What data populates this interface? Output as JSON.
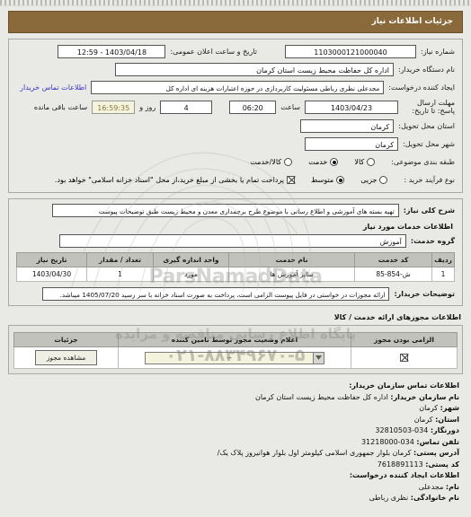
{
  "header": {
    "title": "جزئیات اطلاعات نیاز"
  },
  "colors": {
    "header_bg": "#8a6a3b",
    "link": "#3a34c7",
    "table_header_bg": "#c2c2bd",
    "select_bg": "#f4f3dd"
  },
  "need_info": {
    "need_number_label": "شماره نیاز:",
    "need_number_value": "1103000121000040",
    "announce_datetime_label": "تاریخ و ساعت اعلان عمومی:",
    "announce_datetime_value": "1403/04/18 - 12:59",
    "buyer_org_label": "نام دستگاه خریدار:",
    "buyer_org_value": "اداره کل حفاظت محیط زیست استان کرمان",
    "creator_label": "ایجاد کننده درخواست:",
    "creator_value": "مجدعلی نظری رباطی مسئولیت کاربردازی در حوزه اعتبارات هزینه ای اداره کل",
    "contact_link": "اطلاعات تماس خریدار",
    "deadline_label": "مهلت ارسال پاسخ: تا تاریخ:",
    "deadline_date": "1403/04/23",
    "deadline_hour_label": "ساعت",
    "deadline_hour": "06:20",
    "days_value": "4",
    "days_label": "روز و",
    "remaining_value": "16:59:35",
    "remaining_label": "ساعت باقی مانده",
    "province_label": "استان محل تحویل:",
    "province_value": "کرمان",
    "city_label": "شهر محل تحویل:",
    "city_value": "کرمان",
    "category_label": "طبقه بندی موضوعی:",
    "category_options": [
      {
        "label": "کالا",
        "selected": false
      },
      {
        "label": "خدمت",
        "selected": true
      },
      {
        "label": "کالا/خدمت",
        "selected": false
      }
    ],
    "process_label": "نوع فرآیند خرید :",
    "process_options": [
      {
        "label": "جزیی",
        "selected": false
      },
      {
        "label": "متوسط",
        "selected": true
      }
    ],
    "payment_checkbox_checked": true,
    "payment_text": "پرداخت تمام یا بخشی از مبلغ خرید،از محل \"اسناد خزانه اسلامی\" خواهد بود."
  },
  "need_desc": {
    "label": "شرح کلی نیاز:",
    "value": "تهیه بسته های آموزشی و اطلاع رسانی با موضوع طرح برچمداری معدن و محیط زیست طبق توضیحات پیوست",
    "services_heading": "اطلاعات خدمات مورد نیاز",
    "group_label": "گروه خدمت:",
    "group_value": "آموزش",
    "table": {
      "columns": [
        "ردیف",
        "کد خدمت",
        "نام خدمت",
        "واحد اندازه گیری",
        "تعداد / مقدار",
        "تاریخ نیاز"
      ],
      "rows": [
        [
          "1",
          "ش-854-85",
          "سایر آموزش ها",
          "مورد",
          "1",
          "1403/04/30"
        ]
      ]
    },
    "buyer_notes_label": "توضیحات خریدار:",
    "buyer_notes_value": "ارائه مجوزات در خواستی در فایل پیوست الزامی است، پرداخت به صورت اسناد خزانه با سر رسید 1405/07/20 میباشد."
  },
  "permits": {
    "heading": "اطلاعات مجوزهای ارائه خدمت / کالا",
    "table": {
      "columns": [
        "الزامی بودن مجوز",
        "اعلام وضعیت مجوز توسط تامین کننده",
        "جزئیات"
      ],
      "rows": [
        {
          "required_checked": true,
          "status_value": "--",
          "details_button": "مشاهده مجوز"
        }
      ]
    }
  },
  "contact": {
    "section_title": "اطلاعات تماس سازمان خریدار:",
    "org_name_label": "نام سازمان خریدار:",
    "org_name_value": "اداره کل حفاظت محیط زیست استان کرمان",
    "city_label": "شهر:",
    "city_value": "کرمان",
    "province_label": "استان:",
    "province_value": "کرمان",
    "fax_label": "دورنگار:",
    "fax_value": "32810503-034",
    "phone_label": "تلفن تماس:",
    "phone_value": "31218000-034",
    "address_label": "آدرس پستی:",
    "address_value": "کرمان بلوار جمهوری اسلامی کیلومتر اول بلوار هوانیروز پلاک یک/",
    "postal_code_label": "کد پستی:",
    "postal_code_value": "7618891113",
    "creator_section_title": "اطلاعات ایجاد کننده درخواست:",
    "first_name_label": "نام:",
    "first_name_value": "مجدعلی",
    "last_name_label": "نام خانوادگی:",
    "last_name_value": "نظری رباطی"
  },
  "watermarks": {
    "brand": "ParsNamadData",
    "site_text": "پایگاه اطلاع رسانی مناقصه و مزایده",
    "phone": "۰۲۱-۸۸۳۴۹۶۷۰-۵"
  }
}
